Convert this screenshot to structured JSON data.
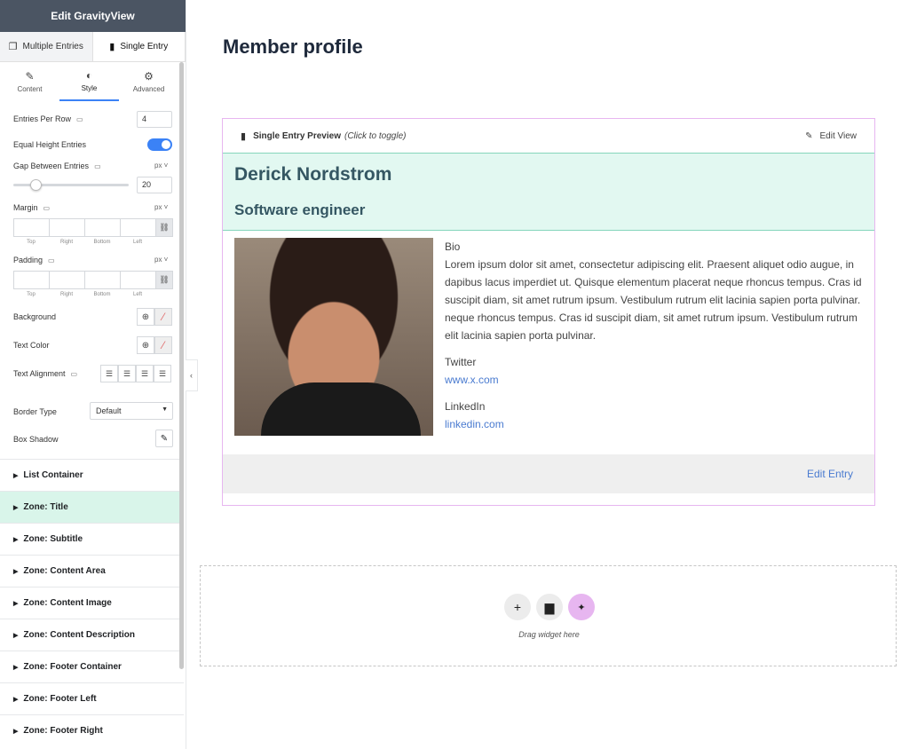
{
  "sidebar": {
    "title": "Edit GravityView",
    "view_tabs": [
      {
        "label": "Multiple Entries",
        "icon": "copy-icon"
      },
      {
        "label": "Single Entry",
        "icon": "document-icon"
      }
    ],
    "settings_tabs": [
      {
        "label": "Content",
        "icon": "pencil-icon"
      },
      {
        "label": "Style",
        "icon": "contrast-icon"
      },
      {
        "label": "Advanced",
        "icon": "gear-icon"
      }
    ],
    "controls": {
      "entries_per_row_label": "Entries Per Row",
      "entries_per_row_value": "4",
      "equal_height_label": "Equal Height Entries",
      "equal_height_on": true,
      "gap_label": "Gap Between Entries",
      "gap_unit": "px",
      "gap_value": "20",
      "margin_label": "Margin",
      "margin_unit": "px",
      "padding_label": "Padding",
      "padding_unit": "px",
      "dim_labels": [
        "Top",
        "Right",
        "Bottom",
        "Left"
      ],
      "background_label": "Background",
      "text_color_label": "Text Color",
      "text_alignment_label": "Text Alignment",
      "border_type_label": "Border Type",
      "border_type_value": "Default",
      "box_shadow_label": "Box Shadow"
    },
    "sections": [
      {
        "label": "List Container",
        "active": false
      },
      {
        "label": "Zone: Title",
        "active": true
      },
      {
        "label": "Zone: Subtitle",
        "active": false
      },
      {
        "label": "Zone: Content Area",
        "active": false
      },
      {
        "label": "Zone: Content Image",
        "active": false
      },
      {
        "label": "Zone: Content Description",
        "active": false
      },
      {
        "label": "Zone: Footer Container",
        "active": false
      },
      {
        "label": "Zone: Footer Left",
        "active": false
      },
      {
        "label": "Zone: Footer Right",
        "active": false
      }
    ]
  },
  "main": {
    "page_title": "Member profile",
    "preview": {
      "label": "Single Entry Preview",
      "hint": "(Click to toggle)",
      "edit_view": "Edit View"
    },
    "entry": {
      "name": "Derick Nordstrom",
      "job_title": "Software engineer",
      "bio_label": "Bio",
      "bio_text": "Lorem ipsum dolor sit amet, consectetur adipiscing elit. Praesent aliquet odio augue, in dapibus lacus imperdiet ut. Quisque elementum placerat neque rhoncus tempus. Cras id suscipit diam, sit amet rutrum ipsum. Vestibulum rutrum elit lacinia sapien porta pulvinar. neque rhoncus tempus. Cras id suscipit diam, sit amet rutrum ipsum. Vestibulum rutrum elit lacinia sapien porta pulvinar.",
      "twitter_label": "Twitter",
      "twitter_link": "www.x.com",
      "linkedin_label": "LinkedIn",
      "linkedin_link": "linkedin.com",
      "edit_entry": "Edit Entry"
    },
    "dropzone": {
      "hint": "Drag widget here"
    }
  },
  "colors": {
    "accent": "#3b82f6",
    "title_zone_bg": "#e2f8f1",
    "preview_border": "#e7b6f0",
    "link": "#4a7bd0"
  }
}
